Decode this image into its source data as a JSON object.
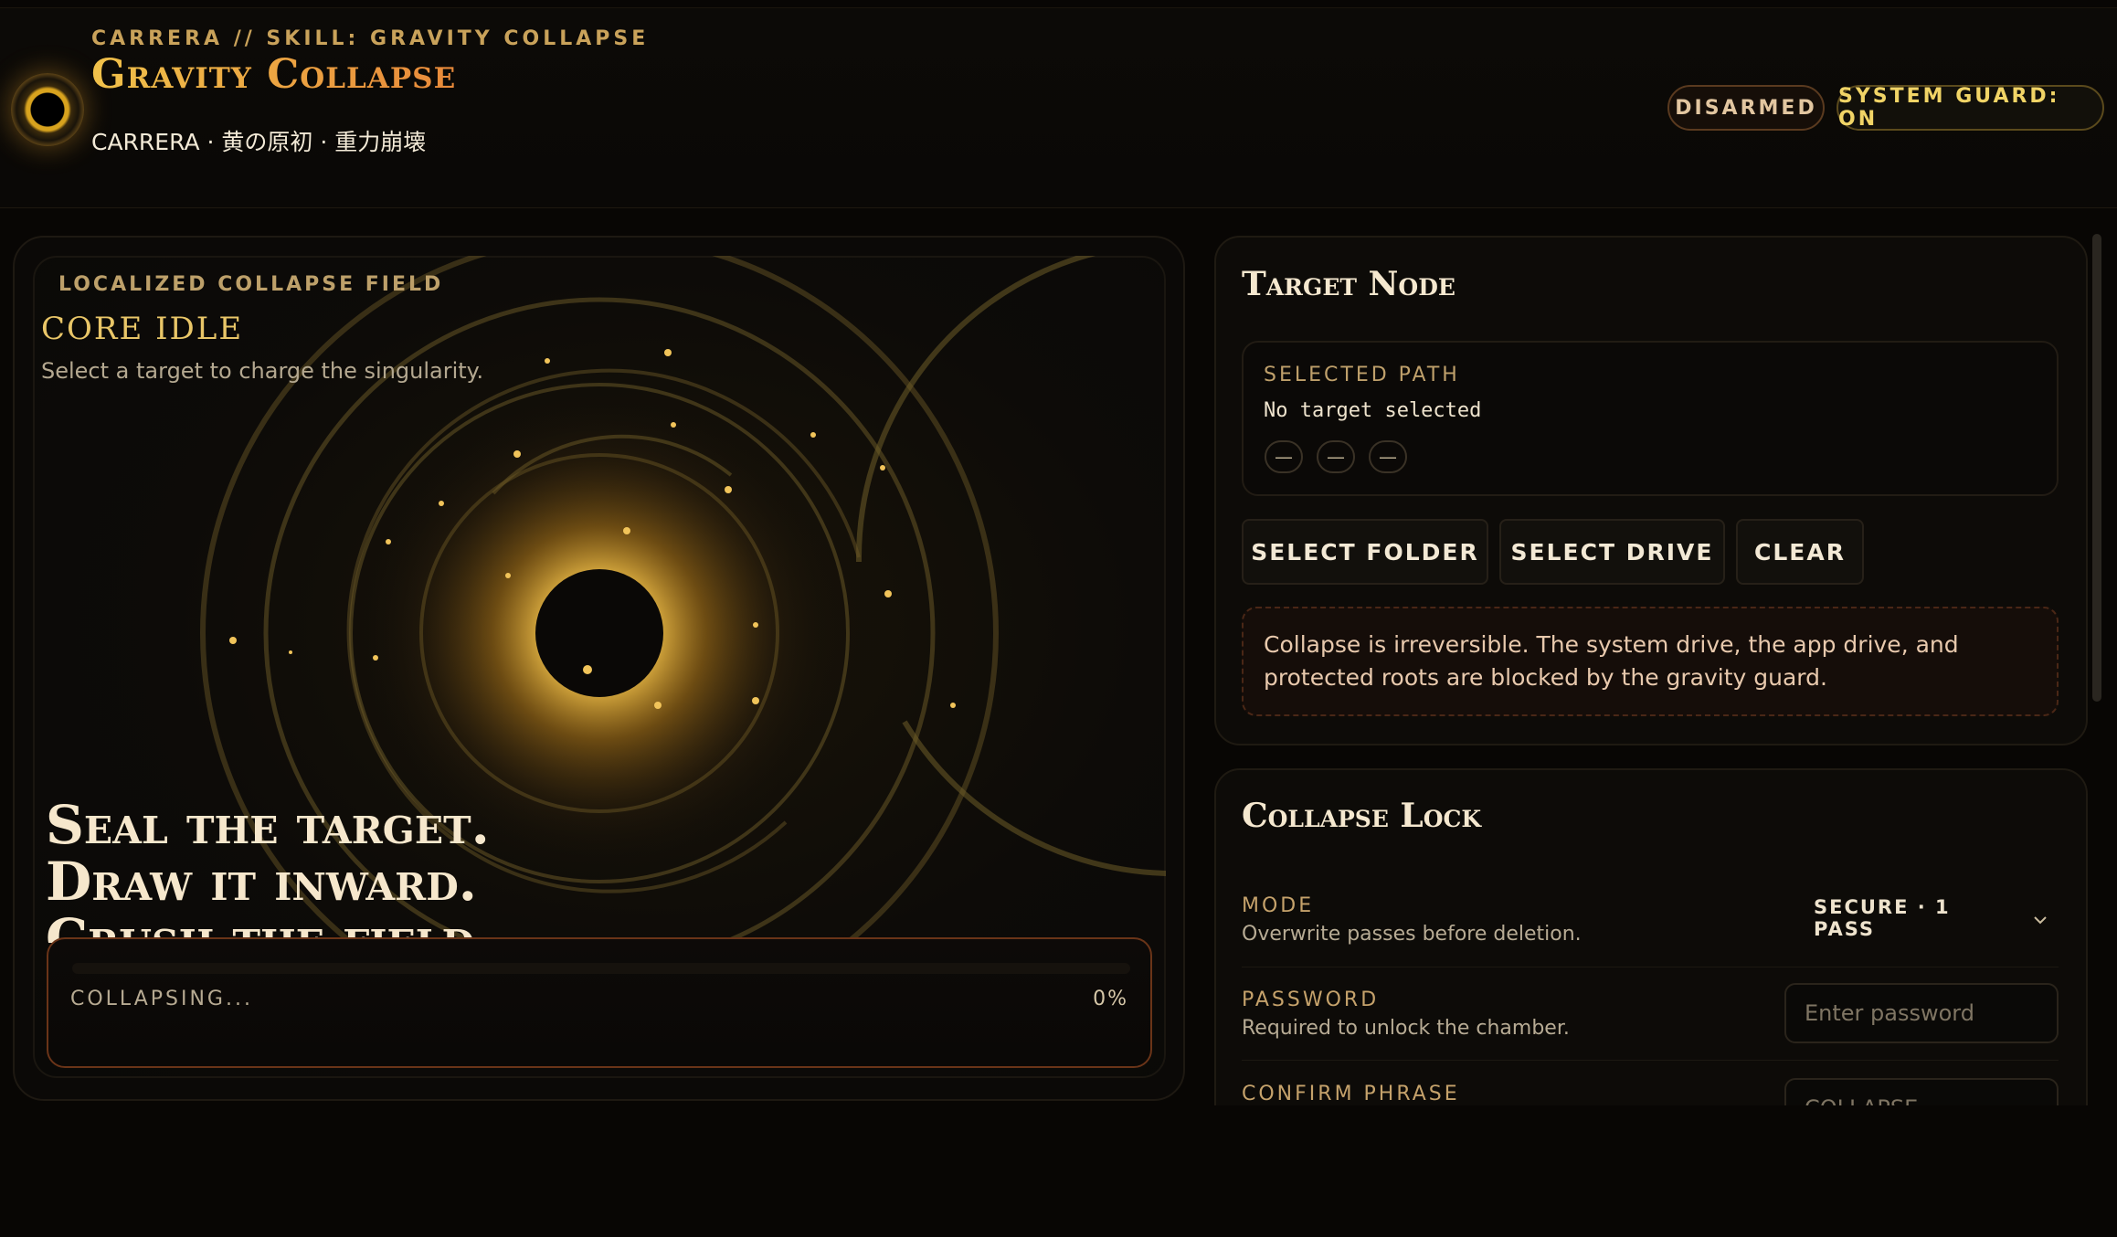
{
  "header": {
    "eyebrow": "CARRERA // SKILL: GRAVITY COLLAPSE",
    "title": "Gravity Collapse",
    "subtitle": "CARRERA · 黄の原初 · 重力崩壊",
    "badges": {
      "disarmed": "DISARMED",
      "guard": "SYSTEM GUARD: ON"
    },
    "logo_icon": "black-hole-icon"
  },
  "field": {
    "label": "LOCALIZED COLLAPSE FIELD",
    "status": "CORE IDLE",
    "hint": "Select a target to charge the singularity.",
    "headline": [
      "Seal the target.",
      "Draw it inward.",
      "Crush the field."
    ],
    "progress": {
      "label": "COLLAPSING...",
      "percent_text": "0%",
      "value": 0
    },
    "colors": {
      "accent": "#e0a83a",
      "ring": "#6b5a2a"
    }
  },
  "target": {
    "title": "Target Node",
    "path_label": "SELECTED PATH",
    "path_value": "No target selected",
    "meta_chips": [
      "—",
      "—",
      "—"
    ],
    "buttons": {
      "folder": "SELECT FOLDER",
      "drive": "SELECT DRIVE",
      "clear": "CLEAR"
    },
    "warning": "Collapse is irreversible. The system drive, the app drive, and protected roots are blocked by the gravity guard."
  },
  "lock": {
    "title": "Collapse Lock",
    "mode": {
      "label": "MODE",
      "sub": "Overwrite passes before deletion.",
      "value": "SECURE · 1 PASS"
    },
    "password": {
      "label": "PASSWORD",
      "sub": "Required to unlock the chamber.",
      "placeholder": "Enter password"
    },
    "confirm": {
      "label": "CONFIRM PHRASE",
      "placeholder": "COLLAPSE"
    }
  }
}
